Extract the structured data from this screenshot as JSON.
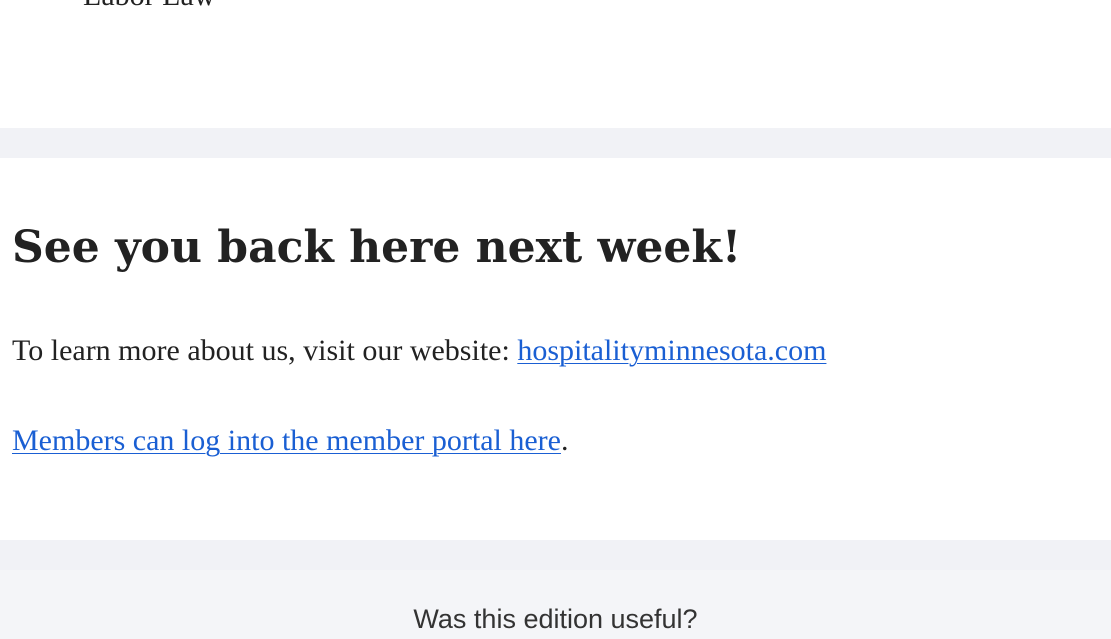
{
  "top_section": {
    "list_item_text": "Labor Law"
  },
  "closing": {
    "headline": "See you back here next week!",
    "learn_more_prefix": "To learn more about us, visit our website: ",
    "website_link_text": "hospitalityminnesota.com",
    "member_portal_link_text": "Members can log into the member portal here",
    "member_portal_suffix": "."
  },
  "feedback": {
    "question": "Was this edition useful?"
  },
  "colors": {
    "link": "#1a5fd3",
    "divider_band": "#f1f2f6",
    "footer_background": "#f4f5f8",
    "body_text": "#222222"
  }
}
